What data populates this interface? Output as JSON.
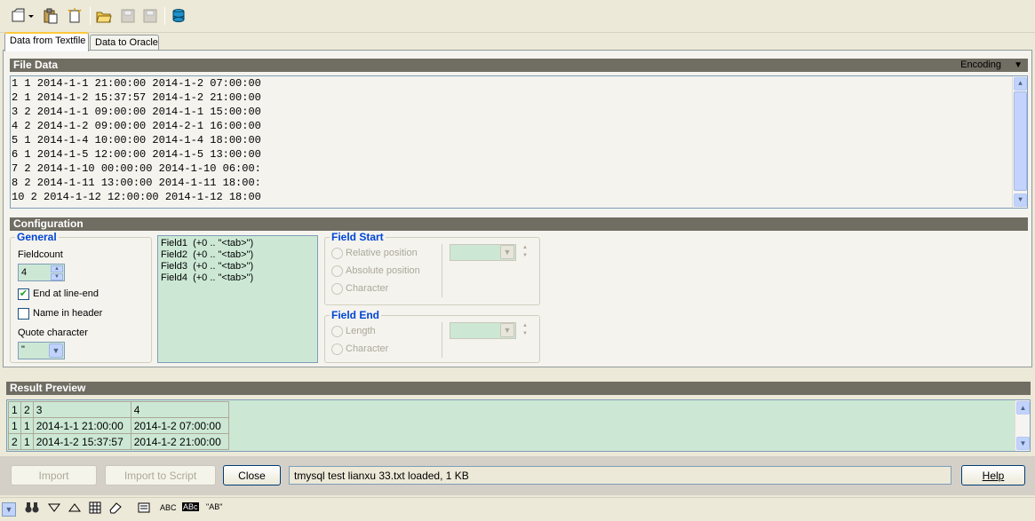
{
  "toolbar": {
    "icons": [
      "new-dropdown-icon",
      "paste-icon",
      "clear-icon",
      "open-folder-icon",
      "save-icon",
      "save-as-icon",
      "database-icon"
    ]
  },
  "tabs": [
    {
      "label": "Data from Textfile",
      "active": true
    },
    {
      "label": "Data to Oracle",
      "active": false
    }
  ],
  "file_data": {
    "title": "File Data",
    "encoding_label": "Encoding",
    "lines": [
      "1 1 2014-1-1 21:00:00 2014-1-2 07:00:00",
      "2 1 2014-1-2 15:37:57 2014-1-2 21:00:00",
      "3 2 2014-1-1 09:00:00 2014-1-1 15:00:00",
      "4 2 2014-1-2 09:00:00 2014-2-1 16:00:00",
      "5 1 2014-1-4 10:00:00 2014-1-4 18:00:00",
      "6 1 2014-1-5 12:00:00 2014-1-5 13:00:00",
      "7 2 2014-1-10 00:00:00 2014-1-10 06:00:",
      "8 2 2014-1-11 13:00:00 2014-1-11 18:00:",
      "10 2 2014-1-12 12:00:00 2014-1-12 18:00"
    ]
  },
  "configuration": {
    "title": "Configuration",
    "general": {
      "legend": "General",
      "fieldcount_label": "Fieldcount",
      "fieldcount_value": "4",
      "end_at_line_end_label": "End at line-end",
      "end_at_line_end_checked": true,
      "name_in_header_label": "Name in header",
      "name_in_header_checked": false,
      "quote_char_label": "Quote character",
      "quote_char_value": "\""
    },
    "fields": [
      "Field1  (+0 .. \"<tab>\")",
      "Field2  (+0 .. \"<tab>\")",
      "Field3  (+0 .. \"<tab>\")",
      "Field4  (+0 .. \"<tab>\")"
    ],
    "field_start": {
      "legend": "Field Start",
      "options": [
        "Relative position",
        "Absolute position",
        "Character"
      ]
    },
    "field_end": {
      "legend": "Field End",
      "options": [
        "Length",
        "Character"
      ]
    }
  },
  "result_preview": {
    "title": "Result Preview",
    "headers": [
      "1",
      "2",
      "3",
      "4"
    ],
    "rows": [
      [
        "1",
        "1",
        "2014-1-1 21:00:00",
        "2014-1-2 07:00:00"
      ],
      [
        "2",
        "1",
        "2014-1-2 15:37:57",
        "2014-1-2 21:00:00"
      ]
    ]
  },
  "buttons": {
    "import": "Import",
    "import_to_script": "Import to Script",
    "close": "Close",
    "help": "Help"
  },
  "status_text": "tmysql  test  lianxu  33.txt loaded,  1 KB",
  "bottom_toolbar": {
    "abc_label": "ABC",
    "abc_small_label": "ABc",
    "ab_quote_label": "\"AB\""
  },
  "colors": {
    "chrome": "#ece9d8",
    "section_bar": "#706d63",
    "green_fill": "#cce8d4",
    "legend_blue": "#0046d5"
  }
}
